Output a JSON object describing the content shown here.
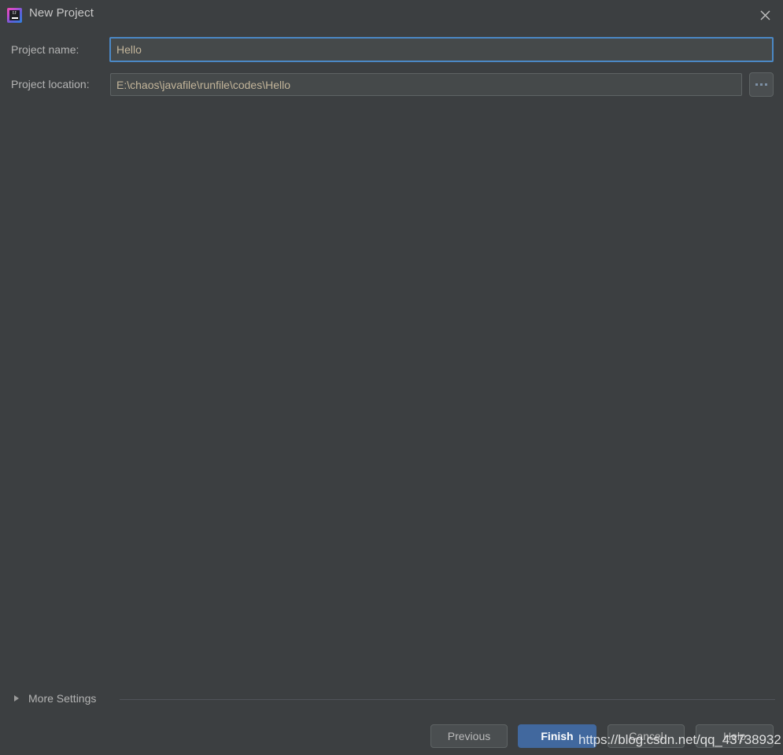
{
  "window": {
    "title": "New Project",
    "icon": "intellij-idea-icon",
    "icon_letters": "IJ",
    "close_icon": "close-icon"
  },
  "form": {
    "name_label": "Project name:",
    "name_value": "Hello",
    "name_placeholder": "",
    "location_label": "Project location:",
    "location_value": "E:\\chaos\\javafile\\runfile\\codes\\Hello",
    "location_placeholder": "",
    "browse_icon": "ellipsis-icon",
    "browse_label": "..."
  },
  "more_settings": {
    "label": "More Settings",
    "expand_icon": "chevron-right-icon",
    "expanded": false
  },
  "footer": {
    "previous_label": "Previous",
    "finish_label": "Finish",
    "cancel_label": "Cancel",
    "help_label": "Help"
  },
  "watermark": {
    "text": "https://blog.csdn.net/qq_43738932"
  },
  "colors": {
    "background": "#3c3f41",
    "field_background": "#45494a",
    "focus_border": "#4b88c5",
    "accent_button": "#41689e",
    "text": "#bbbbbb",
    "value_text": "#c3b59a"
  }
}
